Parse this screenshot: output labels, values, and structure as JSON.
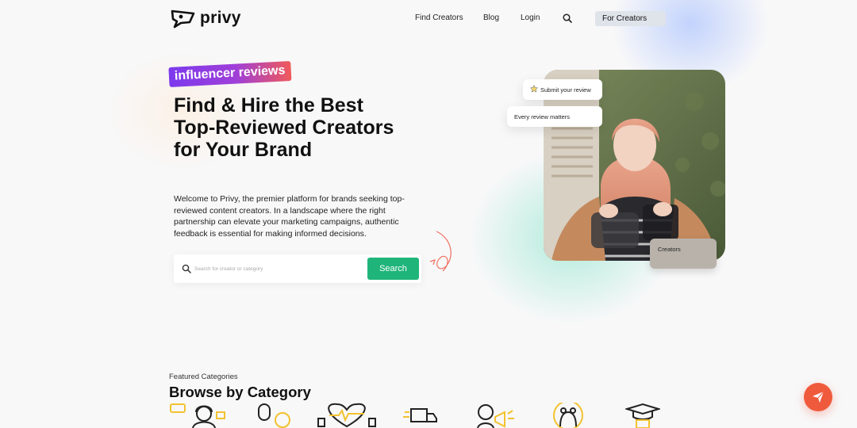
{
  "brand": {
    "name": "privy"
  },
  "nav": {
    "links": [
      "Find Creators",
      "Blog",
      "Login"
    ],
    "cta": "For Creators"
  },
  "hero": {
    "badge": "influencer reviews",
    "title": "Find & Hire the Best Top-Reviewed Creators for Your Brand",
    "description": "Welcome to Privy, the premier platform for brands seeking top-reviewed content creators. In a landscape where the right partnership can elevate your marketing campaigns, authentic feedback is essential for making informed decisions.",
    "search": {
      "placeholder": "Search for creator or category",
      "button": "Search"
    }
  },
  "floating": {
    "submit_review": "Submit your review",
    "every_review": "Every review matters",
    "creators": "Creators"
  },
  "categories": {
    "eyebrow": "Featured Categories",
    "title": "Browse by Category",
    "icons": [
      "gaming-icon",
      "podcast-icon",
      "fitness-icon",
      "delivery-icon",
      "marketing-icon",
      "pets-icon",
      "education-icon"
    ]
  },
  "colors": {
    "accent": "#1fb57a",
    "badge_start": "#7c3aed",
    "badge_end": "#f05a5a",
    "fab": "#f05a3c",
    "icon_yellow": "#f2c230"
  }
}
